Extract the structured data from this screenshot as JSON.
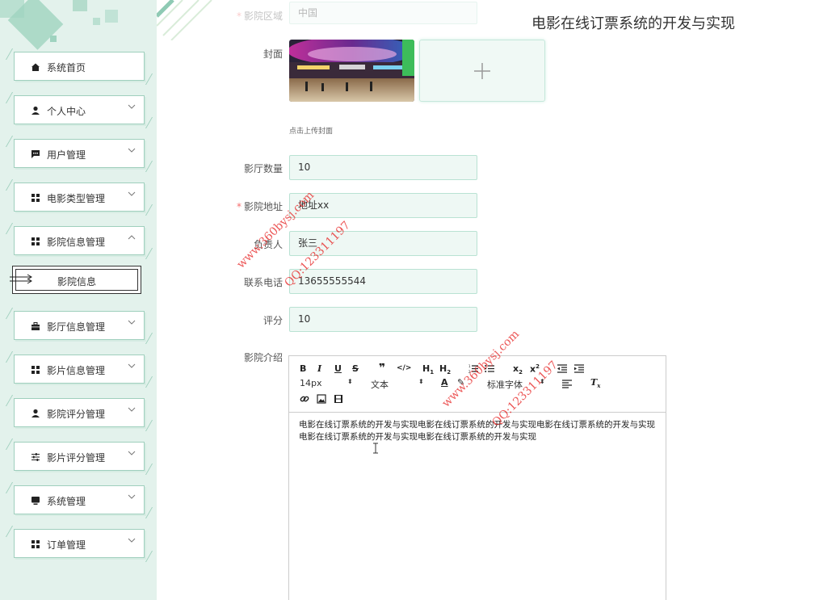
{
  "header": {
    "title": "电影在线订票系统的开发与实现"
  },
  "sidebar": {
    "items": [
      {
        "label": "系统首页",
        "icon": "home-icon",
        "expandable": false
      },
      {
        "label": "个人中心",
        "icon": "user-icon",
        "expandable": true
      },
      {
        "label": "用户管理",
        "icon": "chat-icon",
        "expandable": true
      },
      {
        "label": "电影类型管理",
        "icon": "grid-icon",
        "expandable": true
      },
      {
        "label": "影院信息管理",
        "icon": "grid-icon",
        "expandable": true,
        "expanded": true
      },
      {
        "label": "影厅信息管理",
        "icon": "briefcase-icon",
        "expandable": true
      },
      {
        "label": "影片信息管理",
        "icon": "grid-icon",
        "expandable": true
      },
      {
        "label": "影院评分管理",
        "icon": "person-icon",
        "expandable": true
      },
      {
        "label": "影片评分管理",
        "icon": "sliders-icon",
        "expandable": true
      },
      {
        "label": "系统管理",
        "icon": "monitor-icon",
        "expandable": true
      },
      {
        "label": "订单管理",
        "icon": "grid-icon",
        "expandable": true
      }
    ],
    "active_sub": {
      "label": "影院信息"
    }
  },
  "form": {
    "region": {
      "label": "影院区域",
      "value": "中国"
    },
    "cover": {
      "label": "封面",
      "hint": "点击上传封面"
    },
    "hall_count": {
      "label": "影厅数量",
      "value": "10"
    },
    "address": {
      "label": "影院地址",
      "value": "地址xx"
    },
    "manager": {
      "label": "负责人",
      "value": "张三"
    },
    "phone": {
      "label": "联系电话",
      "value": "13655555544"
    },
    "rating": {
      "label": "评分",
      "value": "10"
    },
    "intro": {
      "label": "影院介绍",
      "content": "电影在线订票系统的开发与实现电影在线订票系统的开发与实现电影在线订票系统的开发与实现电影在线订票系统的开发与实现电影在线订票系统的开发与实现"
    }
  },
  "editor_toolbar": {
    "font_size": "14px",
    "text_style": "文本",
    "font_family": "标准字体"
  },
  "watermarks": {
    "site": "www.360bysj.com",
    "qq": "QQ:123311197"
  },
  "colors": {
    "accent": "#9fd3bf",
    "input_bg": "#eef8f4",
    "required": "#f56c6c"
  }
}
